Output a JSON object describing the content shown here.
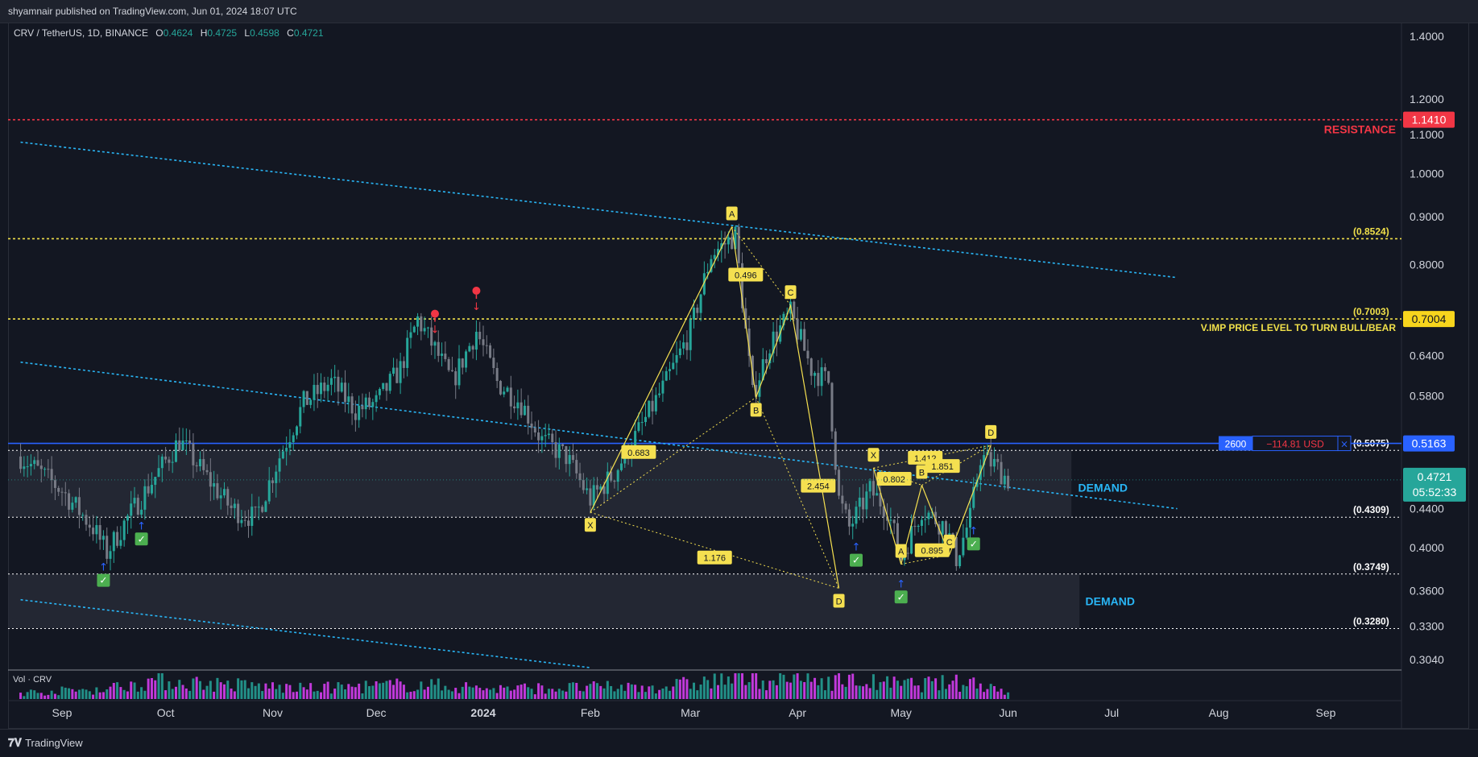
{
  "header": {
    "published": "shyamnair published on TradingView.com, Jun 01, 2024 18:07 UTC"
  },
  "legend": {
    "symbol": "CRV / TetherUS, 1D, BINANCE",
    "open_label": "O",
    "open": "0.4624",
    "high_label": "H",
    "high": "0.4725",
    "low_label": "L",
    "low": "0.4598",
    "close_label": "C",
    "close": "0.4721"
  },
  "volume": {
    "label": "Vol · CRV"
  },
  "footer": {
    "brand": "TradingView"
  },
  "colors": {
    "bg": "#131722",
    "up": "#26a69a",
    "down": "#787b86",
    "resistance": "#f23645",
    "fib": "#f0e04a",
    "channel": "#29b6f6",
    "demand_text": "#29b6f6",
    "pattern": "#f5e050"
  },
  "chart_data": {
    "type": "candlestick",
    "symbol": "CRV / TetherUS",
    "timeframe": "1D",
    "exchange": "BINANCE",
    "ohlc_last": {
      "open": 0.4624,
      "high": 0.4725,
      "low": 0.4598,
      "close": 0.4721
    },
    "y_scale": "log",
    "y_ticks": [
      "1.4000",
      "1.2000",
      "1.1000",
      "1.0000",
      "0.9000",
      "0.8000",
      "0.7000",
      "0.6400",
      "0.5800",
      "0.5200",
      "0.4800",
      "0.4400",
      "0.4000",
      "0.3600",
      "0.3300",
      "0.3040"
    ],
    "x_ticks": [
      "Sep",
      "Oct",
      "Nov",
      "Dec",
      "2024",
      "Feb",
      "Mar",
      "Apr",
      "May",
      "Jun",
      "Jul",
      "Aug",
      "Sep"
    ],
    "price_path": [
      [
        "2023-08-20",
        0.5
      ],
      [
        "2023-09-01",
        0.46
      ],
      [
        "2023-09-10",
        0.42
      ],
      [
        "2023-09-14",
        0.395
      ],
      [
        "2023-09-20",
        0.43
      ],
      [
        "2023-09-27",
        0.47
      ],
      [
        "2023-10-05",
        0.52
      ],
      [
        "2023-10-12",
        0.48
      ],
      [
        "2023-10-20",
        0.44
      ],
      [
        "2023-10-27",
        0.43
      ],
      [
        "2023-11-03",
        0.5
      ],
      [
        "2023-11-10",
        0.57
      ],
      [
        "2023-11-18",
        0.6
      ],
      [
        "2023-11-25",
        0.56
      ],
      [
        "2023-12-01",
        0.57
      ],
      [
        "2023-12-08",
        0.62
      ],
      [
        "2023-12-13",
        0.7
      ],
      [
        "2023-12-18",
        0.65
      ],
      [
        "2023-12-23",
        0.6
      ],
      [
        "2023-12-30",
        0.68
      ],
      [
        "2024-01-05",
        0.6
      ],
      [
        "2024-01-12",
        0.57
      ],
      [
        "2024-01-18",
        0.52
      ],
      [
        "2024-01-25",
        0.5
      ],
      [
        "2024-02-01",
        0.45
      ],
      [
        "2024-02-08",
        0.48
      ],
      [
        "2024-02-16",
        0.54
      ],
      [
        "2024-02-23",
        0.6
      ],
      [
        "2024-03-01",
        0.68
      ],
      [
        "2024-03-07",
        0.82
      ],
      [
        "2024-03-14",
        0.86
      ],
      [
        "2024-03-19",
        0.58
      ],
      [
        "2024-03-24",
        0.66
      ],
      [
        "2024-03-30",
        0.71
      ],
      [
        "2024-04-05",
        0.62
      ],
      [
        "2024-04-10",
        0.6
      ],
      [
        "2024-04-13",
        0.45
      ],
      [
        "2024-04-16",
        0.42
      ],
      [
        "2024-04-22",
        0.46
      ],
      [
        "2024-04-27",
        0.44
      ],
      [
        "2024-05-01",
        0.39
      ],
      [
        "2024-05-07",
        0.44
      ],
      [
        "2024-05-14",
        0.42
      ],
      [
        "2024-05-17",
        0.39
      ],
      [
        "2024-05-21",
        0.43
      ],
      [
        "2024-05-24",
        0.5
      ],
      [
        "2024-05-28",
        0.49
      ],
      [
        "2024-06-01",
        0.4721
      ]
    ],
    "volume_profile": [
      [
        "2023-08-20",
        0.3
      ],
      [
        "2023-09-14",
        0.5
      ],
      [
        "2023-09-27",
        0.9
      ],
      [
        "2023-11-10",
        0.5
      ],
      [
        "2023-12-13",
        0.7
      ],
      [
        "2024-01-05",
        0.5
      ],
      [
        "2024-02-23",
        0.6
      ],
      [
        "2024-03-14",
        1.0
      ],
      [
        "2024-04-13",
        0.9
      ],
      [
        "2024-05-01",
        0.7
      ],
      [
        "2024-05-24",
        0.8
      ],
      [
        "2024-06-01",
        0.3
      ]
    ],
    "horizontal_levels": [
      {
        "value": 1.141,
        "style": "dotted",
        "color": "#f23645",
        "label": "RESISTANCE",
        "badge": "1.1410"
      },
      {
        "value": 0.8524,
        "style": "dotted",
        "color": "#f0e04a",
        "label": "(0.8524)"
      },
      {
        "value": 0.7003,
        "style": "dotted",
        "color": "#f0e04a",
        "label": "(0.7003)",
        "note": "V.IMP PRICE LEVEL TO TURN BULL/BEAR",
        "badge": "0.7004"
      },
      {
        "value": 0.5075,
        "style": "dotted",
        "color": "#ffffff",
        "label": "(0.5075)"
      },
      {
        "value": 0.4309,
        "style": "dotted",
        "color": "#ffffff",
        "label": "(0.4309)"
      },
      {
        "value": 0.3749,
        "style": "dotted",
        "color": "#ffffff",
        "label": "(0.3749)"
      },
      {
        "value": 0.328,
        "style": "dotted",
        "color": "#ffffff",
        "label": "(0.3280)"
      },
      {
        "value": 0.5163,
        "style": "solid",
        "color": "#2962ff",
        "badge": "0.5163"
      }
    ],
    "demand_zones": [
      {
        "top": 0.5075,
        "bottom": 0.4309,
        "label": "DEMAND"
      },
      {
        "top": 0.3749,
        "bottom": 0.328,
        "label": "DEMAND"
      }
    ],
    "position_tag": {
      "qty": "2600",
      "pnl": "−114.81 USD",
      "close": "×"
    },
    "last_price": {
      "value": "0.4721",
      "countdown": "05:52:33"
    },
    "patterns": [
      {
        "name": "X",
        "points": [
          [
            "2024-02-01",
            0.436
          ],
          [
            "2024-03-13",
            0.878
          ],
          [
            "2024-03-20",
            0.578
          ],
          [
            "2024-03-30",
            0.724
          ],
          [
            "2024-04-13",
            0.362
          ]
        ],
        "point_labels": [
          "X",
          "A",
          "B",
          "C",
          "D"
        ],
        "ratios": [
          {
            "at": [
              "2024-02-15",
              0.505
            ],
            "text": "0.683"
          },
          {
            "at": [
              "2024-03-17",
              0.78
            ],
            "text": "0.496"
          },
          {
            "at": [
              "2024-04-07",
              0.465
            ],
            "text": "2.454"
          },
          {
            "at": [
              "2024-03-08",
              0.39
            ],
            "text": "1.176"
          }
        ]
      },
      {
        "name": "Y",
        "points": [
          [
            "2024-04-23",
            0.486
          ],
          [
            "2024-05-01",
            0.384
          ],
          [
            "2024-05-07",
            0.466
          ],
          [
            "2024-05-15",
            0.393
          ],
          [
            "2024-05-27",
            0.514
          ]
        ],
        "point_labels": [
          "X",
          "A",
          "B",
          "C",
          "D"
        ],
        "ratios": [
          {
            "at": [
              "2024-04-29",
              0.473
            ],
            "text": "0.802"
          },
          {
            "at": [
              "2024-05-10",
              0.397
            ],
            "text": "0.895"
          },
          {
            "at": [
              "2024-05-08",
              0.498
            ],
            "text": "1.412"
          },
          {
            "at": [
              "2024-05-13",
              0.488
            ],
            "text": "1.851"
          }
        ]
      }
    ],
    "signals": [
      {
        "kind": "buy",
        "date": "2023-09-13",
        "price": 0.375
      },
      {
        "kind": "buy",
        "date": "2023-09-24",
        "price": 0.415
      },
      {
        "kind": "sell",
        "date": "2023-12-18",
        "price": 0.69
      },
      {
        "kind": "sell",
        "date": "2023-12-30",
        "price": 0.73
      },
      {
        "kind": "buy",
        "date": "2024-04-18",
        "price": 0.394
      },
      {
        "kind": "buy",
        "date": "2024-05-01",
        "price": 0.36
      },
      {
        "kind": "buy",
        "date": "2024-05-22",
        "price": 0.41
      }
    ],
    "channel_lines": [
      {
        "from": [
          "2023-08-20",
          1.08
        ],
        "to": [
          "2024-07-20",
          0.775
        ]
      },
      {
        "from": [
          "2023-08-20",
          0.63
        ],
        "to": [
          "2024-07-20",
          0.44
        ]
      },
      {
        "from": [
          "2023-08-20",
          0.352
        ],
        "to": [
          "2024-02-01",
          0.298
        ]
      }
    ]
  }
}
